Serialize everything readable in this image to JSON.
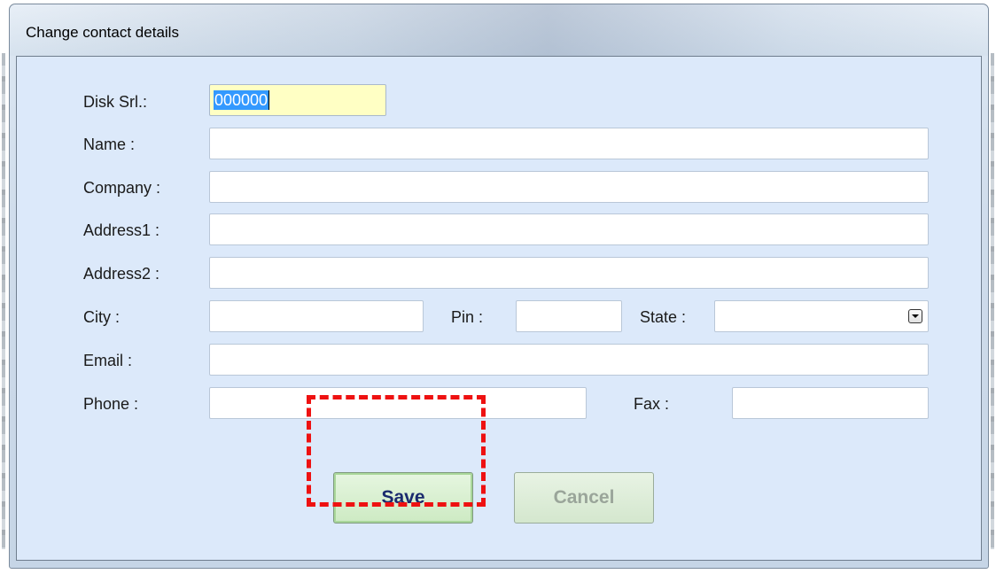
{
  "window": {
    "title": "Change contact details"
  },
  "form": {
    "disk_srl": {
      "label": "Disk Srl.:",
      "value": "000000"
    },
    "name": {
      "label": "Name :",
      "value": ""
    },
    "company": {
      "label": "Company :",
      "value": ""
    },
    "address1": {
      "label": "Address1 :",
      "value": ""
    },
    "address2": {
      "label": "Address2 :",
      "value": ""
    },
    "city": {
      "label": "City :",
      "value": ""
    },
    "pin": {
      "label": "Pin :",
      "value": ""
    },
    "state": {
      "label": "State :",
      "value": ""
    },
    "email": {
      "label": "Email :",
      "value": ""
    },
    "phone": {
      "label": "Phone :",
      "value": ""
    },
    "fax": {
      "label": "Fax :",
      "value": ""
    }
  },
  "buttons": {
    "save_label": "Save",
    "cancel_label": "Cancel"
  },
  "colors": {
    "client_background": "#dce9fa",
    "focused_field": "#ffffc4",
    "selection": "#3399ff",
    "highlight_box": "#ee1111",
    "button_green": "#cdeac3"
  },
  "icons": {
    "state_dropdown": "chevron-down-icon"
  }
}
